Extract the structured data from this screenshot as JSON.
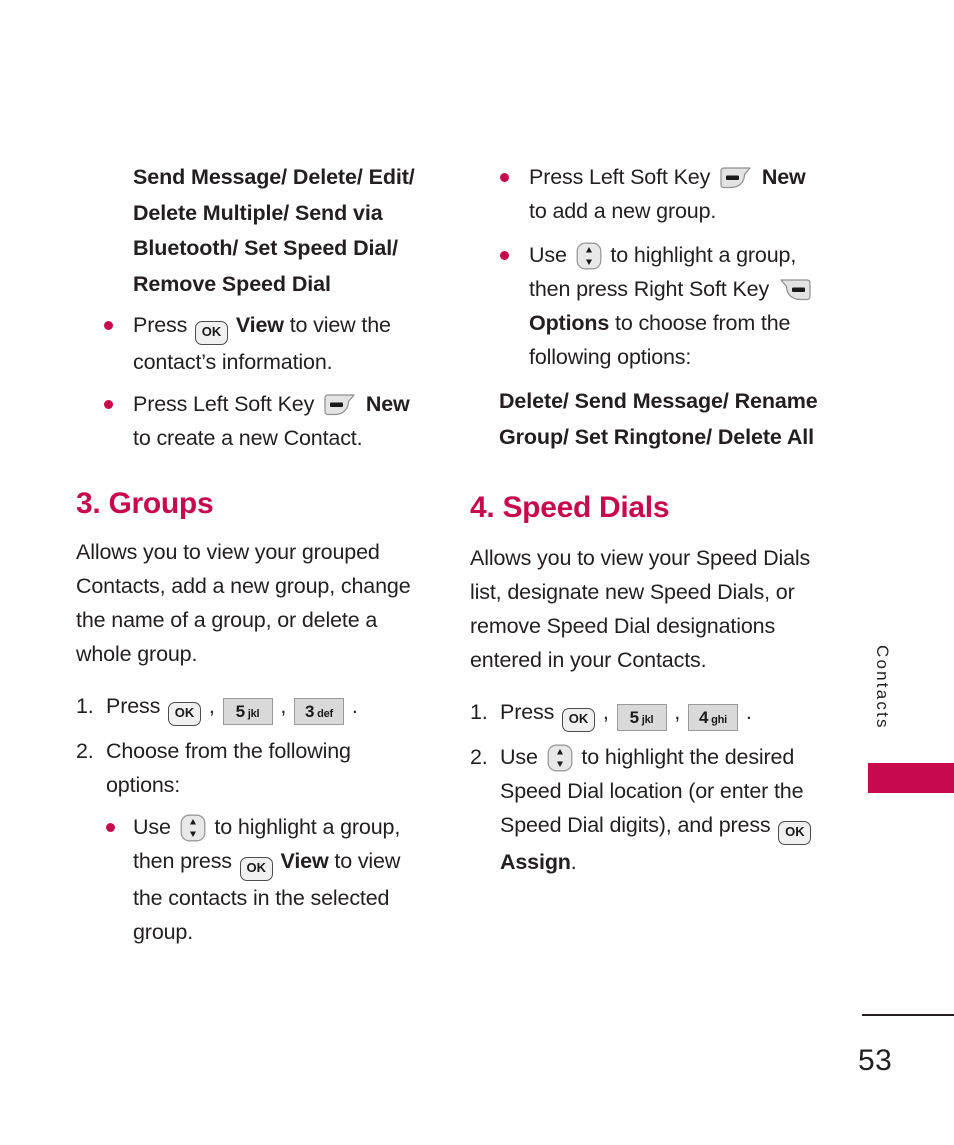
{
  "page": {
    "number": "53",
    "side_tab_label": "Contacts",
    "accent_color": "#c70a4d",
    "text_color": "#231f20"
  },
  "left_column": {
    "options_list": "Send Message/ Delete/ Edit/ Delete Multiple/ Send via Bluetooth/ Set Speed Dial/ Remove Speed Dial",
    "bullets": [
      {
        "parts": [
          {
            "type": "text",
            "value": "Press "
          },
          {
            "type": "key-ok",
            "value": "OK"
          },
          {
            "type": "bold",
            "value": " View "
          },
          {
            "type": "text",
            "value": "to view the contact’s information."
          }
        ]
      },
      {
        "parts": [
          {
            "type": "text",
            "value": "Press Left Soft Key "
          },
          {
            "type": "key-soft-left",
            "value": "left-soft-key"
          },
          {
            "type": "bold",
            "value": " New "
          },
          {
            "type": "text",
            "value": "to create a new Contact."
          }
        ]
      }
    ],
    "section": {
      "heading": "3. Groups",
      "intro": "Allows you to view your grouped Contacts, add a new group, change the name of a group, or delete a whole group.",
      "steps": [
        {
          "num": "1.",
          "parts": [
            {
              "type": "text",
              "value": "Press "
            },
            {
              "type": "key-ok",
              "value": "OK"
            },
            {
              "type": "text",
              "value": " , "
            },
            {
              "type": "key-num",
              "digit": "5",
              "letters": "jkl"
            },
            {
              "type": "text",
              "value": " , "
            },
            {
              "type": "key-num",
              "digit": "3",
              "letters": "def"
            },
            {
              "type": "text",
              "value": " ."
            }
          ]
        },
        {
          "num": "2.",
          "parts": [
            {
              "type": "text",
              "value": "Choose from the following options:"
            }
          ],
          "sub_bullets": [
            {
              "parts": [
                {
                  "type": "text",
                  "value": "Use "
                },
                {
                  "type": "key-nav",
                  "value": "up-down-key"
                },
                {
                  "type": "text",
                  "value": " to highlight a group, then press "
                },
                {
                  "type": "key-ok",
                  "value": "OK"
                },
                {
                  "type": "bold",
                  "value": " View "
                },
                {
                  "type": "text",
                  "value": "to view the contacts in the selected group."
                }
              ]
            }
          ]
        }
      ]
    }
  },
  "right_column": {
    "bullets": [
      {
        "parts": [
          {
            "type": "text",
            "value": "Press Left Soft Key "
          },
          {
            "type": "key-soft-left",
            "value": "left-soft-key"
          },
          {
            "type": "bold",
            "value": " New "
          },
          {
            "type": "text",
            "value": "to add a new group."
          }
        ]
      },
      {
        "parts": [
          {
            "type": "text",
            "value": "Use "
          },
          {
            "type": "key-nav",
            "value": "up-down-key"
          },
          {
            "type": "text",
            "value": " to highlight a group, then press Right Soft Key "
          },
          {
            "type": "key-soft-right",
            "value": "right-soft-key"
          },
          {
            "type": "bold",
            "value": " Options "
          },
          {
            "type": "text",
            "value": "to choose from the following options:"
          }
        ]
      }
    ],
    "options_list": "Delete/ Send Message/ Rename Group/ Set Ringtone/ Delete All",
    "section": {
      "heading": "4. Speed Dials",
      "intro": "Allows you to view your Speed Dials list, designate new Speed Dials, or remove Speed Dial designations entered in your Contacts.",
      "steps": [
        {
          "num": "1.",
          "parts": [
            {
              "type": "text",
              "value": "Press "
            },
            {
              "type": "key-ok",
              "value": "OK"
            },
            {
              "type": "text",
              "value": " , "
            },
            {
              "type": "key-num",
              "digit": "5",
              "letters": "jkl"
            },
            {
              "type": "text",
              "value": " , "
            },
            {
              "type": "key-num",
              "digit": "4",
              "letters": "ghi"
            },
            {
              "type": "text",
              "value": " ."
            }
          ]
        },
        {
          "num": "2.",
          "parts": [
            {
              "type": "text",
              "value": "Use "
            },
            {
              "type": "key-nav",
              "value": "up-down-key"
            },
            {
              "type": "text",
              "value": " to highlight the desired Speed Dial location (or enter the Speed Dial digits), and press "
            },
            {
              "type": "key-ok",
              "value": "OK"
            },
            {
              "type": "bold",
              "value": " Assign"
            },
            {
              "type": "text",
              "value": "."
            }
          ]
        }
      ]
    }
  }
}
